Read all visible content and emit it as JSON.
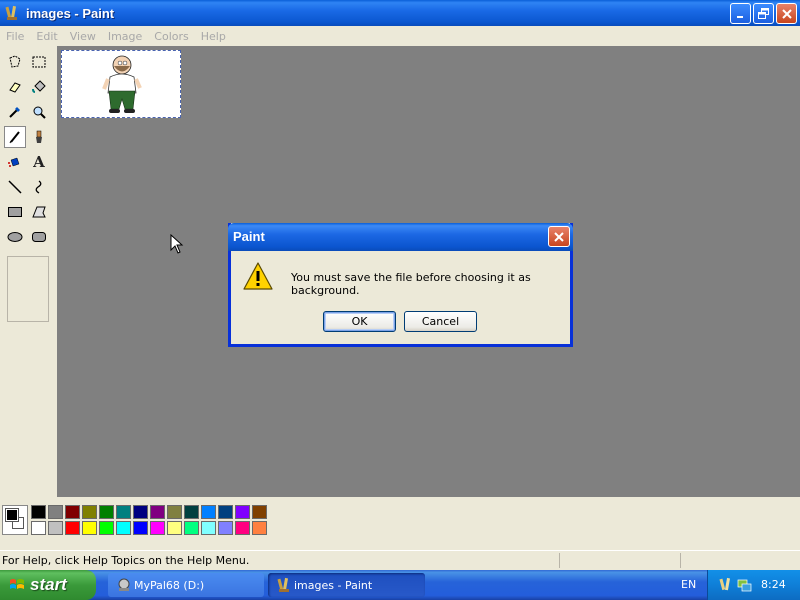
{
  "window": {
    "title": "images - Paint",
    "controls": {
      "minimize": "_",
      "maximize": "❐",
      "close": "✕"
    }
  },
  "menu": [
    "File",
    "Edit",
    "View",
    "Image",
    "Colors",
    "Help"
  ],
  "tools": [
    {
      "name": "free-form-select-icon",
      "glyph": "⬠"
    },
    {
      "name": "select-icon",
      "glyph": "⬚"
    },
    {
      "name": "eraser-icon",
      "glyph": "▱"
    },
    {
      "name": "fill-icon",
      "glyph": "◈"
    },
    {
      "name": "pick-color-icon",
      "glyph": "⟋"
    },
    {
      "name": "magnifier-icon",
      "glyph": "⚲"
    },
    {
      "name": "pencil-icon",
      "glyph": "✎"
    },
    {
      "name": "brush-icon",
      "glyph": "♜"
    },
    {
      "name": "airbrush-icon",
      "glyph": "✦"
    },
    {
      "name": "text-icon",
      "glyph": "A"
    },
    {
      "name": "line-icon",
      "glyph": "╲"
    },
    {
      "name": "curve-icon",
      "glyph": "∫"
    },
    {
      "name": "rectangle-icon",
      "glyph": "▭"
    },
    {
      "name": "polygon-icon",
      "glyph": "⏢"
    },
    {
      "name": "ellipse-icon",
      "glyph": "⬭"
    },
    {
      "name": "rounded-rectangle-icon",
      "glyph": "▢"
    }
  ],
  "dialog": {
    "title": "Paint",
    "message": "You must save the file before choosing it as background.",
    "ok_label": "OK",
    "cancel_label": "Cancel"
  },
  "palette": {
    "foreground": "#000000",
    "background": "#ffffff",
    "row1": [
      "#000000",
      "#808080",
      "#800000",
      "#808000",
      "#008000",
      "#008080",
      "#000080",
      "#800080",
      "#808040",
      "#004040",
      "#0080ff",
      "#004080",
      "#8000ff",
      "#804000"
    ],
    "row2": [
      "#ffffff",
      "#c0c0c0",
      "#ff0000",
      "#ffff00",
      "#00ff00",
      "#00ffff",
      "#0000ff",
      "#ff00ff",
      "#ffff80",
      "#00ff80",
      "#80ffff",
      "#8080ff",
      "#ff0080",
      "#ff8040"
    ]
  },
  "status": {
    "help_text": "For Help, click Help Topics on the Help Menu."
  },
  "taskbar": {
    "start_label": "start",
    "tasks": [
      {
        "label": "MyPal68 (D:)",
        "active": false
      },
      {
        "label": "images - Paint",
        "active": true
      }
    ],
    "language": "EN",
    "clock": "8:24"
  }
}
